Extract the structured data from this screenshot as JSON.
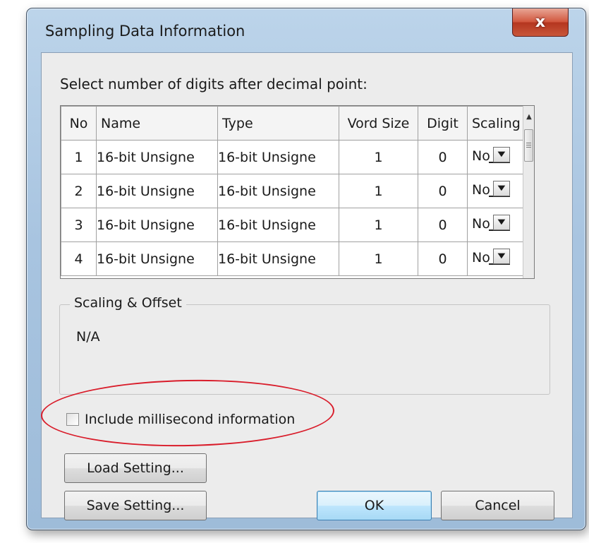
{
  "window": {
    "title": "Sampling Data Information",
    "close_glyph": "x"
  },
  "prompt": "Select number of digits after decimal point:",
  "grid": {
    "headers": [
      "No",
      "Name",
      "Type",
      "Word Size",
      "Digit",
      "Scaling"
    ],
    "headers_visible": [
      "No",
      "Name",
      "Type",
      "Vord Size",
      "Digit",
      "Scaling"
    ],
    "rows": [
      {
        "no": "1",
        "name": "16-bit Unsigne",
        "type": "16-bit Unsigne",
        "word_size": "1",
        "digit": "0",
        "scaling": "No"
      },
      {
        "no": "2",
        "name": "16-bit Unsigne",
        "type": "16-bit Unsigne",
        "word_size": "1",
        "digit": "0",
        "scaling": "No"
      },
      {
        "no": "3",
        "name": "16-bit Unsigne",
        "type": "16-bit Unsigne",
        "word_size": "1",
        "digit": "0",
        "scaling": "No"
      },
      {
        "no": "4",
        "name": "16-bit Unsigne",
        "type": "16-bit Unsigne",
        "word_size": "1",
        "digit": "0",
        "scaling": "No"
      }
    ],
    "dropdown_icon": "chevron-down-icon",
    "scroll_up_icon": "arrow-up-icon"
  },
  "scaling_group": {
    "legend": "Scaling & Offset",
    "value": "N/A"
  },
  "millisecond": {
    "label": "Include millisecond information",
    "checked": false
  },
  "buttons": {
    "load": "Load Setting...",
    "save": "Save Setting...",
    "ok": "OK",
    "cancel": "Cancel"
  },
  "colors": {
    "frame": "#a8c4e0",
    "close_button": "#c8563a",
    "annotation": "#d91c2a",
    "default_button": "#bee6fd"
  }
}
